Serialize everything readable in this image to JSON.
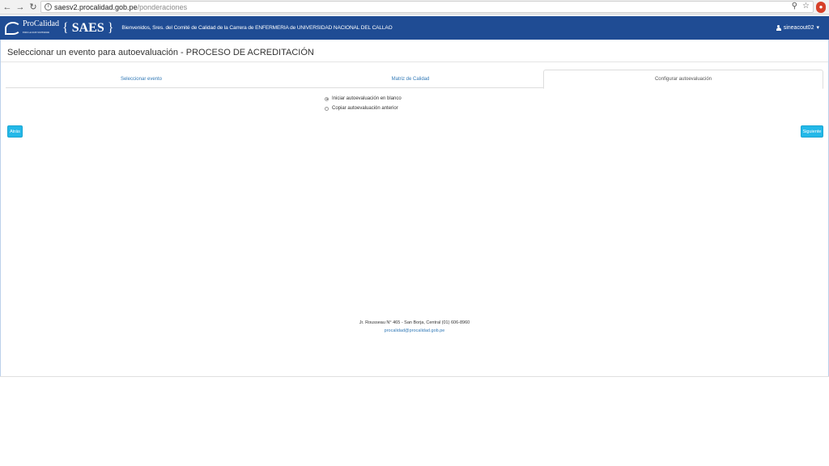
{
  "browser": {
    "url_host": "saesv2.procalidad.gob.pe",
    "url_path": "/ponderaciones"
  },
  "header": {
    "logo_text": "ProCalidad",
    "logo_sub": "EDUCACION SUPERIOR",
    "app_name": "SAES",
    "brace_open": "{",
    "brace_close": "}",
    "welcome": "Bienvenidos, Sres. del Comité de Calidad de la Carrera de ENFERMERIA de UNIVERSIDAD NACIONAL DEL CALLAO",
    "username": "sineacout02"
  },
  "page": {
    "title": "Seleccionar un evento para autoevaluación - PROCESO DE ACREDITACIÓN"
  },
  "tabs": [
    {
      "label": "Seleccionar evento"
    },
    {
      "label": "Matriz de Calidad"
    },
    {
      "label": "Configurar autoevaluación"
    }
  ],
  "options": [
    {
      "label": "Iniciar autoevaluación en blanco",
      "selected": true
    },
    {
      "label": "Copiar autoevaluación anterior",
      "selected": false
    }
  ],
  "buttons": {
    "prev_label": "Atrás",
    "next_label": "Siguiente"
  },
  "footer": {
    "address": "Jr. Rousseau N° 465 - San Borja, Central (01) 606-8960",
    "email": "procalidad@procalidad.gob.pe"
  },
  "colors": {
    "header_bg": "#1f4c94",
    "button_bg": "#23b8e8",
    "link": "#337ab7"
  }
}
